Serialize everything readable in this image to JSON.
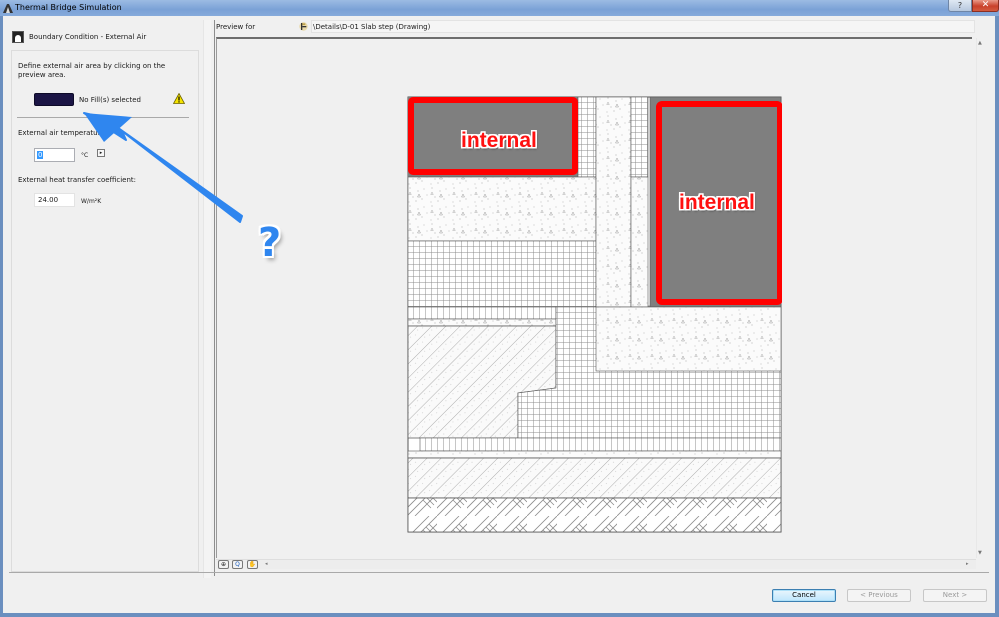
{
  "window": {
    "title": "Thermal Bridge Simulation",
    "help_label": "?",
    "close_label": "✕"
  },
  "left_panel": {
    "header": "Boundary Condition - External Air",
    "description": "Define external air area by clicking on the preview area.",
    "fill_status": "No Fill(s) selected",
    "fill_swatch_color": "#1b1545",
    "temperature_label": "External air temperature:",
    "temperature_value": "0",
    "temperature_unit": "°C",
    "coefficient_label": "External heat transfer coefficient:",
    "coefficient_value": "24.00",
    "coefficient_unit": "W/m²K"
  },
  "preview": {
    "label": "Preview for",
    "path": "\\Details\\D-01 Slab step (Drawing)",
    "tools": [
      "zoom-fit",
      "zoom-in-out",
      "pan"
    ]
  },
  "annotations": {
    "question_mark": "?",
    "internal_labels": [
      "internal",
      "internal"
    ],
    "arrow_color": "#2f86ef",
    "highlight_color": "#ff0000"
  },
  "buttons": {
    "cancel": "Cancel",
    "previous": "< Previous",
    "next": "Next >"
  }
}
